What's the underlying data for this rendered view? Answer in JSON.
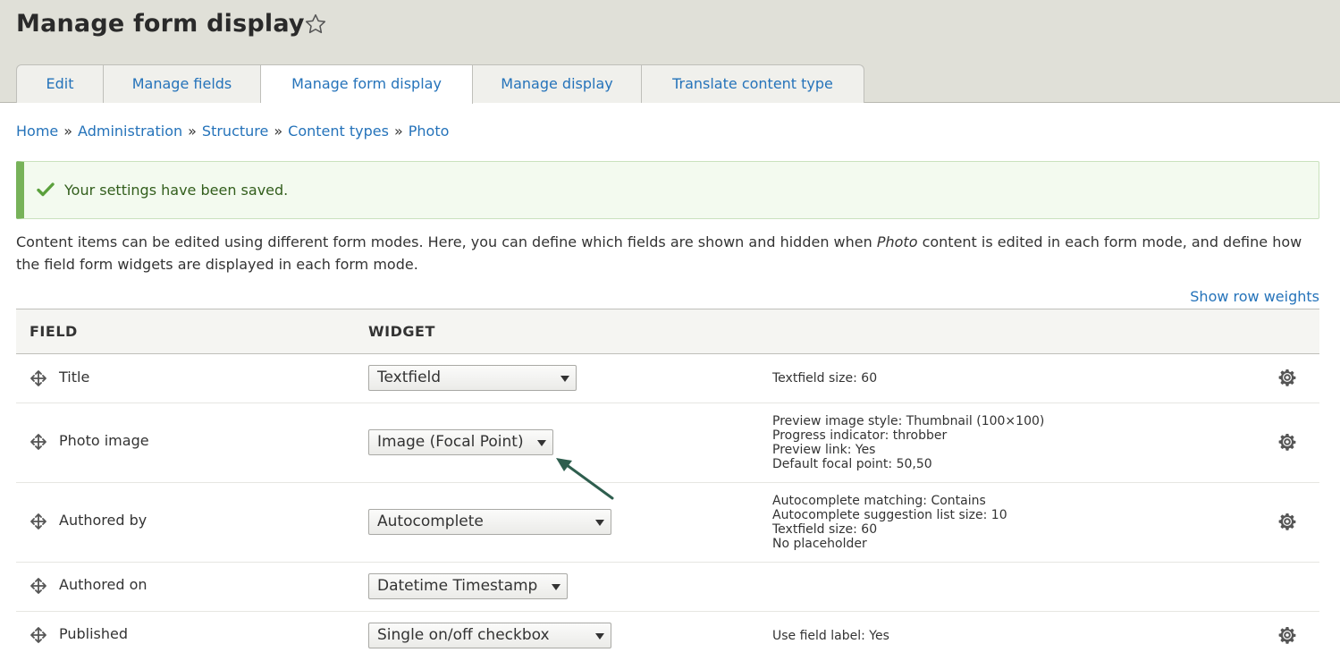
{
  "page": {
    "title": "Manage form display"
  },
  "tabs": [
    {
      "label": "Edit"
    },
    {
      "label": "Manage fields"
    },
    {
      "label": "Manage form display",
      "active": true
    },
    {
      "label": "Manage display"
    },
    {
      "label": "Translate content type"
    }
  ],
  "breadcrumb": {
    "items": [
      "Home",
      "Administration",
      "Structure",
      "Content types",
      "Photo"
    ],
    "separator": "»"
  },
  "message": {
    "text": "Your settings have been saved."
  },
  "help": {
    "part1": "Content items can be edited using different form modes. Here, you can define which fields are shown and hidden when ",
    "emphasis": "Photo",
    "part2": " content is edited in each form mode, and define how the field form widgets are displayed in each form mode."
  },
  "show_row_weights": "Show row weights",
  "table": {
    "headers": {
      "field": "FIELD",
      "widget": "WIDGET"
    },
    "rows": [
      {
        "label": "Title",
        "widget": "Textfield",
        "summary": [
          "Textfield size: 60"
        ],
        "has_settings": true
      },
      {
        "label": "Photo image",
        "widget": "Image (Focal Point)",
        "summary": [
          "Preview image style: Thumbnail (100×100)",
          "Progress indicator: throbber",
          "Preview link: Yes",
          "Default focal point: 50,50"
        ],
        "has_settings": true
      },
      {
        "label": "Authored by",
        "widget": "Autocomplete",
        "summary": [
          "Autocomplete matching: Contains",
          "Autocomplete suggestion list size: 10",
          "Textfield size: 60",
          "No placeholder"
        ],
        "has_settings": true
      },
      {
        "label": "Authored on",
        "widget": "Datetime Timestamp",
        "summary": [],
        "has_settings": false
      },
      {
        "label": "Published",
        "widget": "Single on/off checkbox",
        "summary": [
          "Use field label: Yes"
        ],
        "has_settings": true
      }
    ]
  },
  "colors": {
    "link": "#2573ba",
    "header_bg": "#e0e0d8",
    "success_border": "#77b259",
    "success_bg": "#f3faef",
    "annotation_arrow": "#2e5e4e"
  },
  "icons": {
    "title_star": "star-outline-icon",
    "message": "check-icon",
    "drag": "move-icon",
    "settings": "gear-icon"
  }
}
